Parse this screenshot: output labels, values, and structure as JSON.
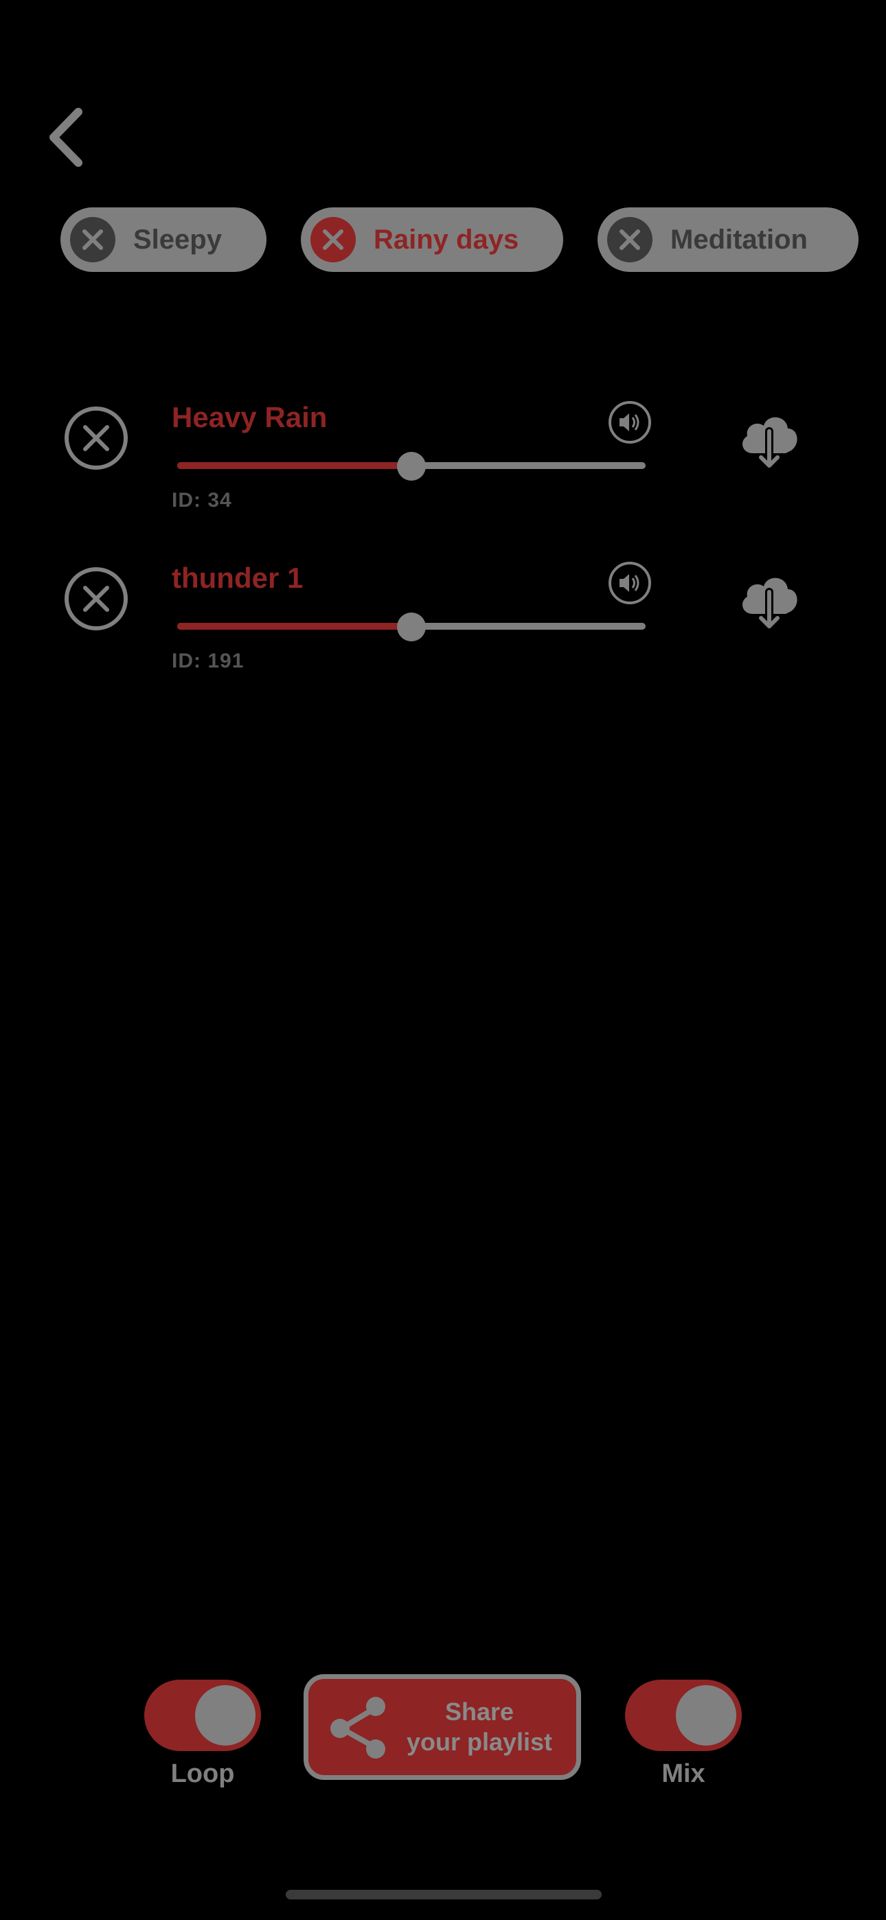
{
  "header": {
    "back_icon": "chevron-left-icon"
  },
  "tags": [
    {
      "label": "Sleepy",
      "active": false
    },
    {
      "label": "Rainy days",
      "active": true
    },
    {
      "label": "Meditation",
      "active": false
    }
  ],
  "sounds": [
    {
      "name": "Heavy Rain",
      "id_text": "ID: 34",
      "volume": 0.5
    },
    {
      "name": "thunder 1",
      "id_text": "ID: 191",
      "volume": 0.5
    }
  ],
  "controls": {
    "loop_label": "Loop",
    "loop_on": true,
    "share_line1": "Share",
    "share_line2": "your playlist",
    "mix_label": "Mix",
    "mix_on": true
  },
  "colors": {
    "background": "#000000",
    "accent": "#8e2424",
    "muted": "#808080",
    "dark": "#3a3a3a"
  }
}
